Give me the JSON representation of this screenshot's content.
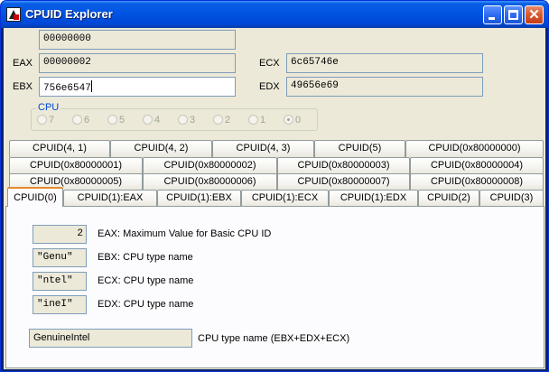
{
  "window": {
    "title": "CPUID Explorer"
  },
  "top_fields": {
    "input_value": "00000000",
    "eax_label": "EAX",
    "eax_value": "00000002",
    "ebx_label": "EBX",
    "ebx_value": "756e6547",
    "ecx_label": "ECX",
    "ecx_value": "6c65746e",
    "edx_label": "EDX",
    "edx_value": "49656e69"
  },
  "cpu_group": {
    "title": "CPU",
    "options": [
      "7",
      "6",
      "5",
      "4",
      "3",
      "2",
      "1",
      "0"
    ],
    "selected": "0"
  },
  "tabs": {
    "row1": [
      "CPUID(4, 1)",
      "CPUID(4, 2)",
      "CPUID(4, 3)",
      "CPUID(5)",
      "CPUID(0x80000000)"
    ],
    "row2": [
      "CPUID(0x80000001)",
      "CPUID(0x80000002)",
      "CPUID(0x80000003)",
      "CPUID(0x80000004)"
    ],
    "row3": [
      "CPUID(0x80000005)",
      "CPUID(0x80000006)",
      "CPUID(0x80000007)",
      "CPUID(0x80000008)"
    ],
    "row4": [
      "CPUID(0)",
      "CPUID(1):EAX",
      "CPUID(1):EBX",
      "CPUID(1):ECX",
      "CPUID(1):EDX",
      "CPUID(2)",
      "CPUID(3)"
    ],
    "active": "CPUID(0)"
  },
  "panel": {
    "rows": [
      {
        "value": "2",
        "desc": "EAX: Maximum Value for Basic CPU ID"
      },
      {
        "value": "\"Genu\"",
        "desc": "EBX: CPU type name"
      },
      {
        "value": "\"ntel\"",
        "desc": "ECX: CPU type name"
      },
      {
        "value": "\"ineI\"",
        "desc": "EDX: CPU type name"
      }
    ],
    "cpu_name_value": "GenuineIntel",
    "cpu_name_desc": "CPU type name (EBX+EDX+ECX)"
  }
}
